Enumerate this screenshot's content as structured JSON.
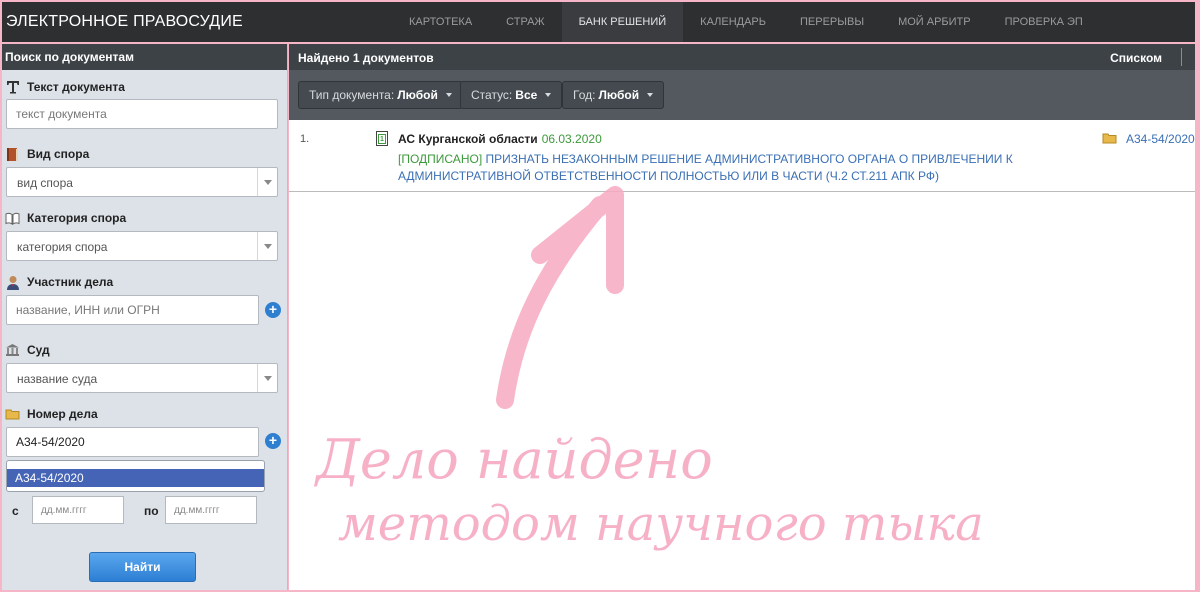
{
  "app": {
    "title": "ЭЛЕКТРОННОЕ ПРАВОСУДИЕ"
  },
  "nav": {
    "items": [
      {
        "label": "КАРТОТЕКА",
        "active": false
      },
      {
        "label": "СТРАЖ",
        "active": false
      },
      {
        "label": "БАНК РЕШЕНИЙ",
        "active": true
      },
      {
        "label": "КАЛЕНДАРЬ",
        "active": false
      },
      {
        "label": "ПЕРЕРЫВЫ",
        "active": false
      },
      {
        "label": "МОЙ АРБИТР",
        "active": false
      },
      {
        "label": "ПРОВЕРКА ЭП",
        "active": false
      }
    ]
  },
  "sidebar": {
    "header": "Поиск по документам",
    "doc_text": {
      "label": "Текст документа",
      "placeholder": "текст документа",
      "value": ""
    },
    "dispute_type": {
      "label": "Вид спора",
      "selected": "вид спора"
    },
    "dispute_category": {
      "label": "Категория спора",
      "selected": "категория спора"
    },
    "participant": {
      "label": "Участник дела",
      "placeholder": "название, ИНН или ОГРН",
      "value": ""
    },
    "court": {
      "label": "Суд",
      "selected": "название суда"
    },
    "case_number": {
      "label": "Номер дела",
      "value": "А34-54/2020",
      "suggestion": "А34-54/2020"
    },
    "date_from": {
      "label": "с",
      "placeholder": "дд.мм.гггг"
    },
    "date_to": {
      "label": "по",
      "placeholder": "дд.мм.гггг"
    },
    "find_button": "Найти"
  },
  "results": {
    "found_text": "Найдено 1 документов",
    "view_mode": "Списком",
    "filters": [
      {
        "label": "Тип документа:",
        "value": "Любой"
      },
      {
        "label": "Статус:",
        "value": "Все"
      },
      {
        "label": "Год:",
        "value": "Любой"
      }
    ],
    "items": [
      {
        "number": "1.",
        "court": "АС Курганской области",
        "date": "06.03.2020",
        "status": "[ПОДПИСАНО]",
        "title_line1": "ПРИЗНАТЬ НЕЗАКОННЫМ РЕШЕНИЕ АДМИНИСТРАТИВНОГО ОРГАНА О ПРИВЛЕЧЕНИИ К",
        "title_line2": "АДМИНИСТРАТИВНОЙ ОТВЕТСТВЕННОСТИ ПОЛНОСТЬЮ ИЛИ В ЧАСТИ (Ч.2 СТ.211 АПК РФ)",
        "case_number": "А34-54/2020"
      }
    ]
  },
  "annotation": {
    "line1": "Дело найдено",
    "line2": "методом научного тыка",
    "color": "#f7a9c1"
  }
}
